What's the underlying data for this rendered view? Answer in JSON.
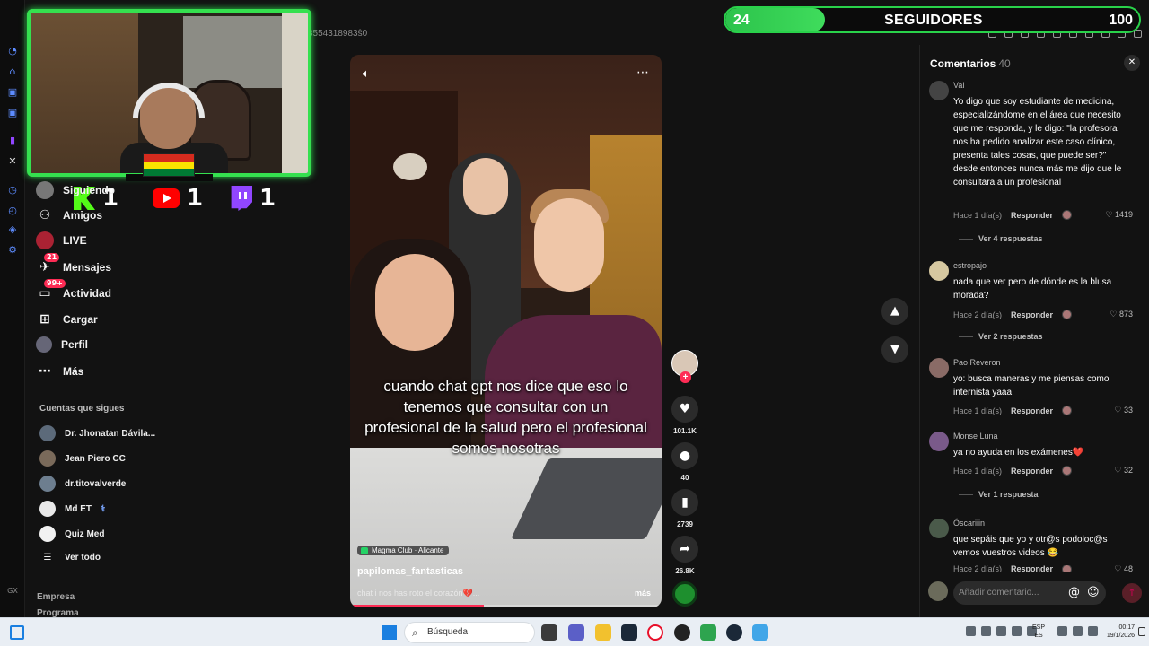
{
  "overlay": {
    "followers_current": "24",
    "followers_label": "SEGUIDORES",
    "followers_goal": "100",
    "followers_progress_fraction": 0.24,
    "counters": [
      {
        "platform": "kick",
        "count": "1"
      },
      {
        "platform": "youtube",
        "count": "1"
      },
      {
        "platform": "twitch",
        "count": "1"
      }
    ]
  },
  "browser": {
    "url_fragment": "3554318983ŝ0"
  },
  "sidebar": {
    "nav": [
      {
        "label": "Siguiendo",
        "icon": "following-icon"
      },
      {
        "label": "Amigos",
        "icon": "friends-icon"
      },
      {
        "label": "LIVE",
        "icon": "live-icon"
      },
      {
        "label": "Mensajes",
        "icon": "messages-icon",
        "badge": "21"
      },
      {
        "label": "Actividad",
        "icon": "activity-icon",
        "badge": "99+"
      },
      {
        "label": "Cargar",
        "icon": "upload-icon"
      },
      {
        "label": "Perfil",
        "icon": "profile-icon"
      },
      {
        "label": "Más",
        "icon": "more-icon"
      }
    ],
    "follows_title": "Cuentas que sigues",
    "follows": [
      {
        "name": "Dr. Jhonatan Dávila..."
      },
      {
        "name": "Jean Piero CC"
      },
      {
        "name": "dr.titovalverde"
      },
      {
        "name": "Md ET",
        "suffix": "⚕"
      },
      {
        "name": "Quiz Med"
      }
    ],
    "see_all": "Ver todo",
    "footer": [
      "Empresa",
      "Programa"
    ]
  },
  "video": {
    "caption": "cuando chat gpt nos dice que eso lo tenemos que consultar con un profesional de la salud pero el profesional somos nosotras",
    "location": "Magma Club · Alicante",
    "username": "papilomas_fantasticas",
    "description": "chat i nos has roto el corazón💔...",
    "more": "más",
    "progress_fraction": 0.43,
    "actions": {
      "likes": "101.1K",
      "comments": "40",
      "saves": "2739",
      "shares": "26.8K"
    }
  },
  "comments": {
    "title": "Comentarios",
    "count": "40",
    "items": [
      {
        "user": "Val",
        "text": "Yo digo que soy estudiante de medicina, especializándome en el área que necesito que me responda, y le digo: \"la profesora nos ha pedido analizar este caso clínico, presenta tales cosas, que puede ser?\" desde entonces nunca más me dijo que le consultara a un profesional",
        "time": "Hace 1 día(s)",
        "reply": "Responder",
        "likes": "1419",
        "replies": "Ver 4 respuestas"
      },
      {
        "user": "estropajo",
        "text": "nada que ver pero de dónde es la blusa morada?",
        "time": "Hace 2 día(s)",
        "reply": "Responder",
        "likes": "873",
        "replies": "Ver 2 respuestas"
      },
      {
        "user": "Pao Reveron",
        "text": "yo: busca maneras y me piensas como internista yaaa",
        "time": "Hace 1 día(s)",
        "reply": "Responder",
        "likes": "33"
      },
      {
        "user": "Monse Luna",
        "text": "ya no ayuda en los exámenes❤️",
        "time": "Hace 1 día(s)",
        "reply": "Responder",
        "likes": "32",
        "replies": "Ver 1 respuesta"
      },
      {
        "user": "Óscariiin",
        "text": "que sepáis que yo y otr@s podoloc@s vemos vuestros videos 😂",
        "time": "Hace 2 día(s)",
        "reply": "Responder",
        "likes": "48"
      }
    ],
    "add_placeholder": "Añadir comentario..."
  },
  "taskbar": {
    "search": "Búsqueda",
    "lang_top": "ESP",
    "lang_bottom": "ES",
    "time": "00:17",
    "date": "19/1/2026"
  },
  "colors": {
    "accent_green": "#29d24a",
    "tiktok_red": "#fe2c55",
    "twitch_purple": "#9146ff",
    "youtube_red": "#ff0000",
    "kick_green": "#53fc18"
  }
}
